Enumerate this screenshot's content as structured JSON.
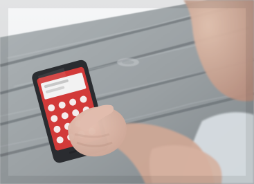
{
  "scene": {
    "subject": "person-holding-smartphone-over-wooden-table",
    "colors": {
      "sky": "#eef1f3",
      "wood": "#9ea3a6",
      "wood_light": "#b7bcbf",
      "wood_dark": "#6f767a",
      "phone_body": "#2a2c30",
      "phone_screen_red": "#d23a39",
      "skin": "#d8b3a2",
      "shirt": "#d9dee2"
    }
  }
}
